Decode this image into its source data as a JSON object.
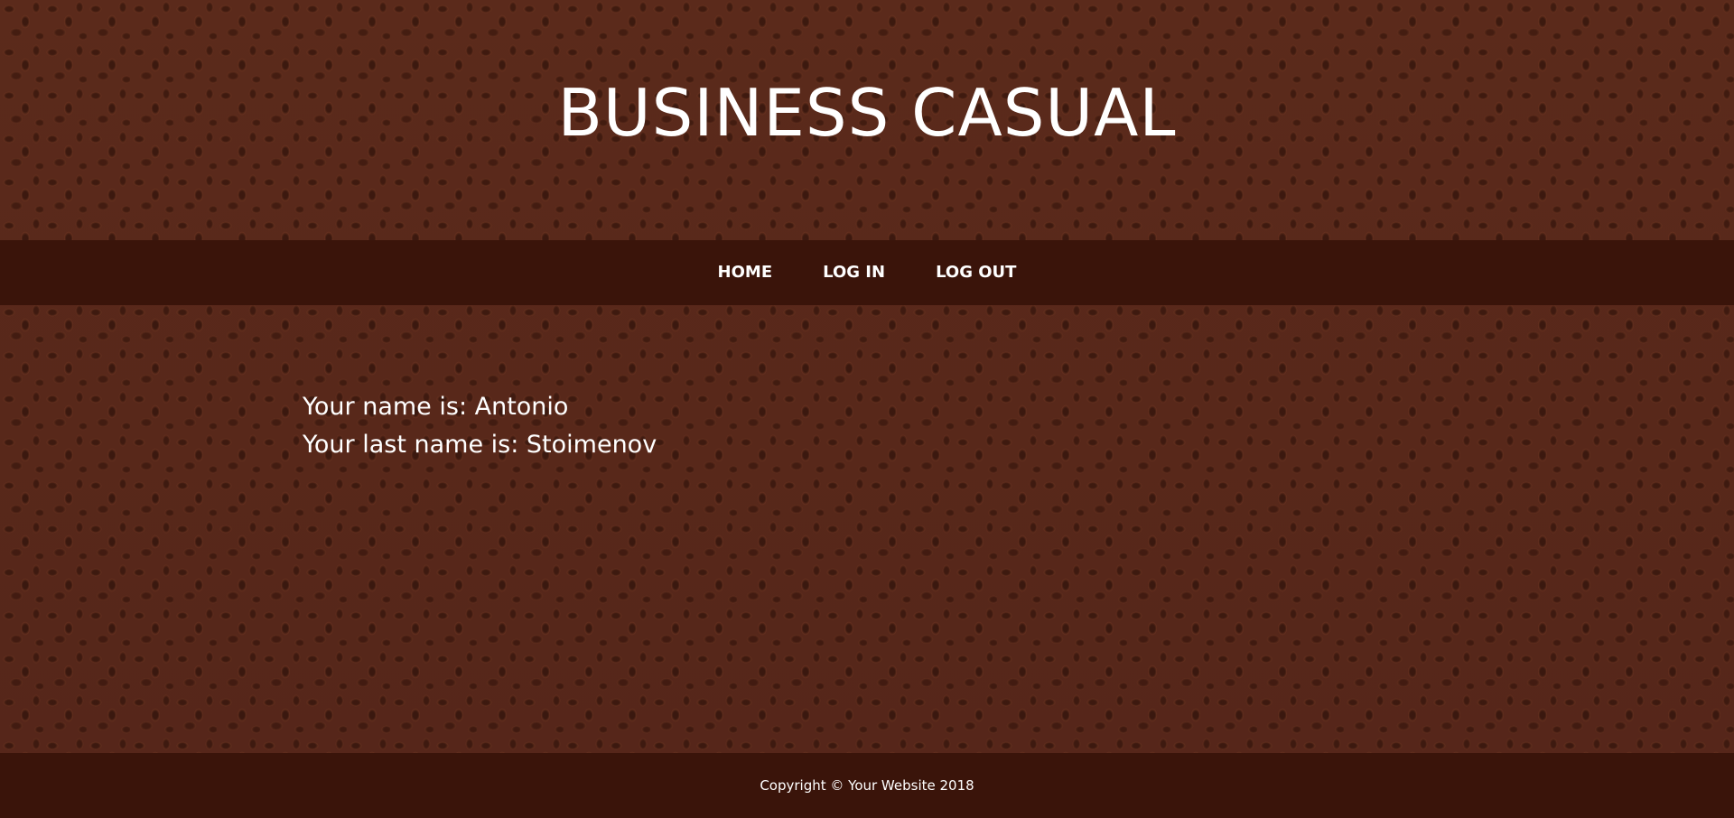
{
  "header": {
    "title": "BUSINESS CASUAL"
  },
  "nav": {
    "items": [
      {
        "label": "HOME"
      },
      {
        "label": "LOG IN"
      },
      {
        "label": "LOG OUT"
      }
    ]
  },
  "content": {
    "name_line": "Your name is: Antonio",
    "last_name_line": "Your last name is: Stoimenov"
  },
  "footer": {
    "copyright": "Copyright © Your Website 2018"
  },
  "colors": {
    "background": "#5a2a1a",
    "bar": "#3a140a",
    "text": "#ffffff"
  }
}
